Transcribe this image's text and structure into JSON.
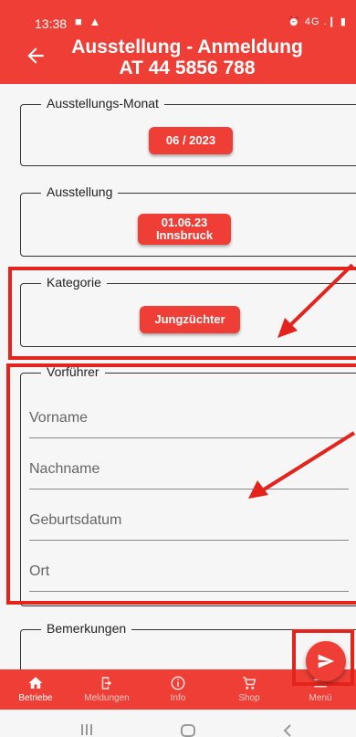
{
  "status_bar": {
    "time": "13:38",
    "left_icons": "■ ▲",
    "right_icons": "⏰ 4G .❙ ▮"
  },
  "header": {
    "title_line1": "Ausstellung - Anmeldung",
    "title_line2": "AT 44 5856 788"
  },
  "sections": {
    "monat": {
      "legend": "Ausstellungs-Monat",
      "value": "06 / 2023"
    },
    "ausstellung": {
      "legend": "Ausstellung",
      "value_line1": "01.06.23",
      "value_line2": "Innsbruck"
    },
    "kategorie": {
      "legend": "Kategorie",
      "value": "Jungzüchter"
    },
    "vorfuehrer": {
      "legend": "Vorführer",
      "fields": [
        {
          "placeholder": "Vorname"
        },
        {
          "placeholder": "Nachname"
        },
        {
          "placeholder": "Geburtsdatum"
        },
        {
          "placeholder": "Ort"
        }
      ]
    },
    "bemerkungen": {
      "legend": "Bemerkungen"
    }
  },
  "bottom_nav": [
    {
      "label": "Betriebe",
      "icon": "home-icon"
    },
    {
      "label": "Meldungen",
      "icon": "logout-icon"
    },
    {
      "label": "Info",
      "icon": "info-icon"
    },
    {
      "label": "Shop",
      "icon": "cart-icon"
    },
    {
      "label": "Menü",
      "icon": "menu-icon"
    }
  ],
  "colors": {
    "primary": "#ef3e36",
    "annotation": "#e3231c",
    "background": "#f7f6f6"
  }
}
